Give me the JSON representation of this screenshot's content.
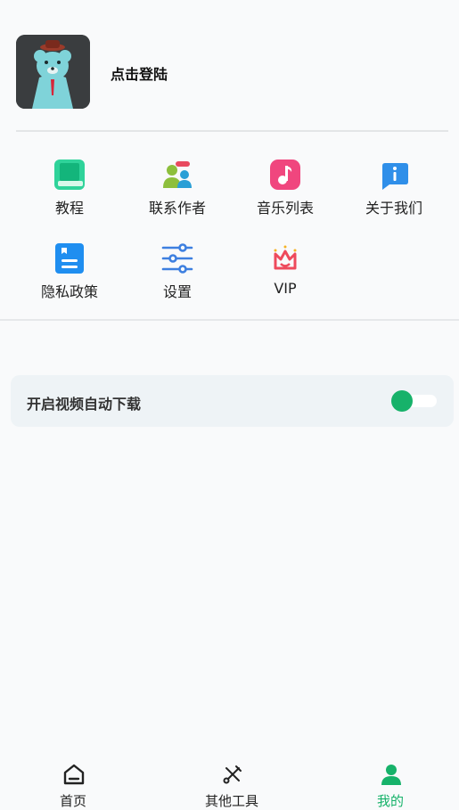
{
  "profile": {
    "login_text": "点击登陆"
  },
  "menu": {
    "items": [
      {
        "label": "教程",
        "icon": "book-icon"
      },
      {
        "label": "联系作者",
        "icon": "contact-icon"
      },
      {
        "label": "音乐列表",
        "icon": "music-icon"
      },
      {
        "label": "关于我们",
        "icon": "info-icon"
      },
      {
        "label": "隐私政策",
        "icon": "privacy-doc-icon"
      },
      {
        "label": "设置",
        "icon": "sliders-icon"
      },
      {
        "label": "VIP",
        "icon": "crown-icon"
      }
    ]
  },
  "settings": {
    "auto_download": {
      "label": "开启视频自动下载",
      "enabled": true
    }
  },
  "bottom_nav": {
    "items": [
      {
        "label": "首页",
        "icon": "home-icon",
        "active": false
      },
      {
        "label": "其他工具",
        "icon": "tools-icon",
        "active": false
      },
      {
        "label": "我的",
        "icon": "user-icon",
        "active": true
      }
    ]
  },
  "colors": {
    "accent": "#17b26a",
    "card_bg": "#eef3f6",
    "background": "#f9fafb"
  }
}
